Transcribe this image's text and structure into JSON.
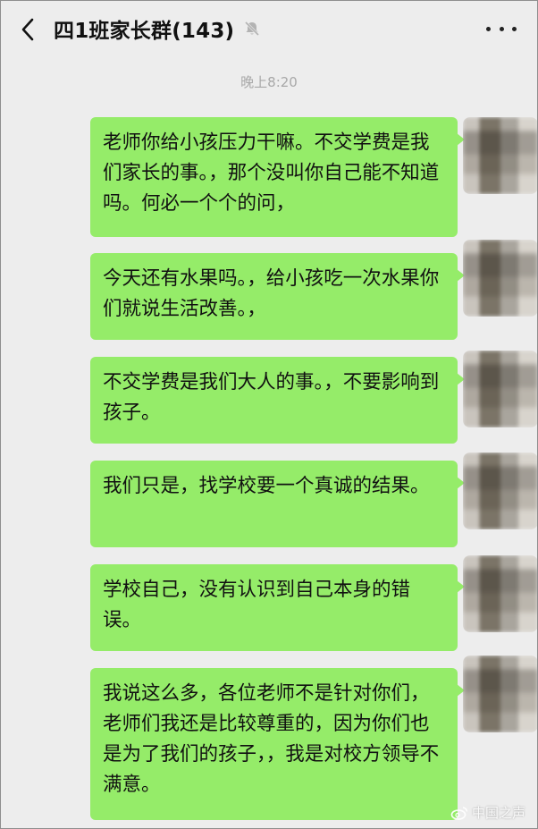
{
  "header": {
    "title": "四1班家长群(143)",
    "back_icon": "chevron-left-icon",
    "mute_icon": "bell-off-icon",
    "more_icon": "more-dots-icon"
  },
  "timestamp": "晚上8:20",
  "messages": [
    {
      "text": "老师你给小孩压力干嘛。不交学费是我们家长的事。，那个没叫你自己能不知道吗。何必一个个的问，"
    },
    {
      "text": "今天还有水果吗。，给小孩吃一次水果你们就说生活改善。，"
    },
    {
      "text": "不交学费是我们大人的事。，不要影响到孩子。"
    },
    {
      "text": "我们只是，找学校要一个真诚的结果。"
    },
    {
      "text": "学校自己，没有认识到自己本身的错误。"
    },
    {
      "text": "我说这么多，各位老师不是针对你们，老师们我还是比较尊重的，因为你们也是为了我们的孩子，，我是对校方领导不满意。"
    }
  ],
  "watermark": {
    "text": "中国之声",
    "icon": "weibo-icon"
  },
  "colors": {
    "bubble": "#95ec69",
    "background": "#ededed"
  }
}
